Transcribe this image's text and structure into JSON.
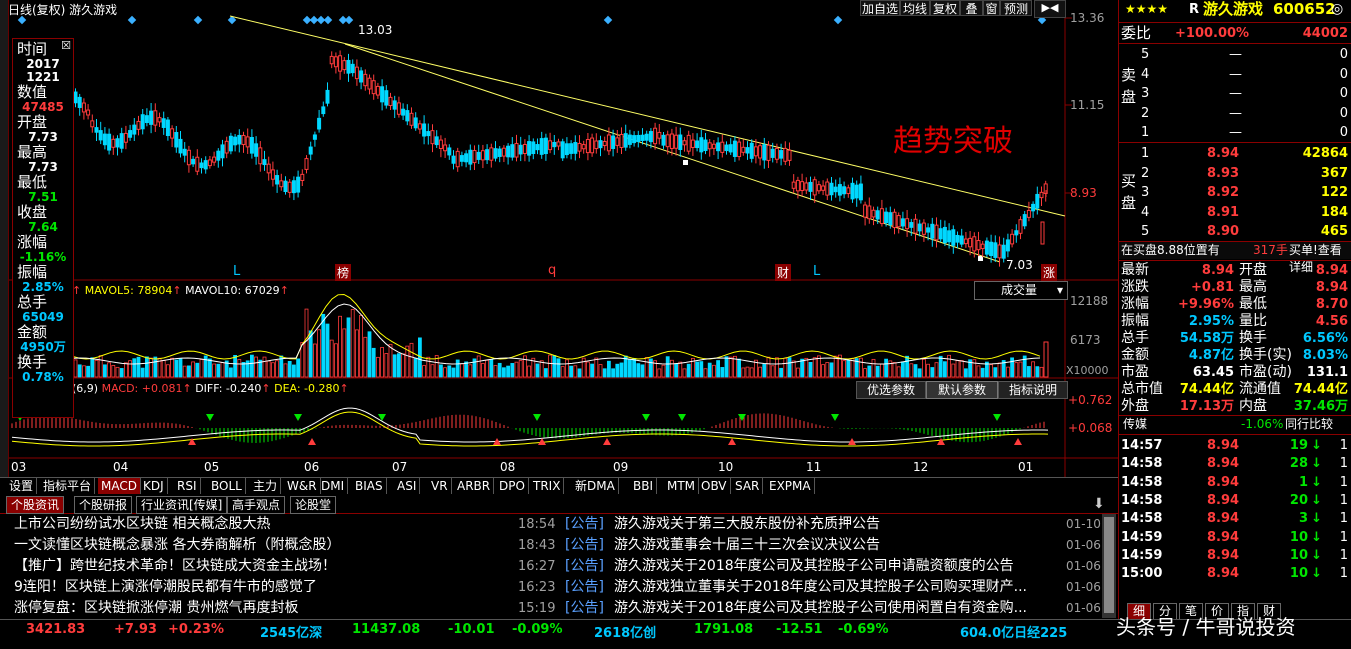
{
  "chart_title": "日线(复权)  游久游戏",
  "toolbar": [
    "加自选",
    "均线",
    "复权",
    "叠",
    "窗",
    "预测"
  ],
  "price_axis": [
    "13.36",
    "11.15",
    "8.93"
  ],
  "vol_axis": [
    "12188",
    "6173",
    "X10000"
  ],
  "macd_axis": [
    "0.762",
    "0.068"
  ],
  "months": [
    "03",
    "04",
    "05",
    "06",
    "07",
    "08",
    "09",
    "10",
    "11",
    "12",
    "01"
  ],
  "annot_high": "13.03",
  "annot_low": "7.03",
  "trend_text": "趋势突破",
  "markers": [
    "L",
    "榜",
    "q",
    "财",
    "L",
    "涨"
  ],
  "mavol": {
    "l5": "MAVOL5: 78904",
    "l10": "MAVOL10: 67029",
    "sel": "成交量"
  },
  "macd_legend": {
    "p": "(6,9)",
    "macd": "MACD: +0.081",
    "diff": "DIFF: -0.240",
    "dea": "DEA: -0.280"
  },
  "param_btns": [
    "优选参数",
    "默认参数",
    "指标说明"
  ],
  "info": [
    {
      "k": "时间",
      "v": "2017",
      "c": "white"
    },
    {
      "k": "",
      "v": "1221",
      "c": "white"
    },
    {
      "k": "数值",
      "v": "47485",
      "c": "red"
    },
    {
      "k": "开盘",
      "v": "7.73",
      "c": "white"
    },
    {
      "k": "最高",
      "v": "7.73",
      "c": "white"
    },
    {
      "k": "最低",
      "v": "7.51",
      "c": "green"
    },
    {
      "k": "收盘",
      "v": "7.64",
      "c": "green"
    },
    {
      "k": "涨幅",
      "v": "-1.16%",
      "c": "green"
    },
    {
      "k": "振幅",
      "v": "2.85%",
      "c": "cyan"
    },
    {
      "k": "总手",
      "v": "65049",
      "c": "cyan"
    },
    {
      "k": "金额",
      "v": "4950万",
      "c": "cyan"
    },
    {
      "k": "换手",
      "v": "0.78%",
      "c": "cyan"
    }
  ],
  "indicator_tabs": [
    "设置",
    "指标平台",
    "MACD",
    "KDJ",
    "RSI",
    "BOLL",
    "主力",
    "W&R",
    "DMI",
    "BIAS",
    "ASI",
    "VR",
    "ARBR",
    "DPO",
    "TRIX",
    "新DMA",
    "BBI",
    "MTM",
    "OBV",
    "SAR",
    "EXPMA"
  ],
  "news_tabs": [
    "个股资讯",
    "个股研报",
    "行业资讯[传媒]",
    "高手观点",
    "论股堂"
  ],
  "news_left": [
    {
      "t": "上市公司纷纷试水区块链 相关概念股大热",
      "time": "18:54"
    },
    {
      "t": "一文读懂区块链概念暴涨 各大券商解析（附概念股）",
      "time": "18:43"
    },
    {
      "t": "【推广】跨世纪技术革命！区块链成大资金主战场！",
      "time": "16:27"
    },
    {
      "t": "9连阳！区块链上演涨停潮股民都有牛市的感觉了",
      "time": "16:23"
    },
    {
      "t": "涨停复盘：区块链掀涨停潮 贵州燃气再度封板",
      "time": "15:19"
    }
  ],
  "news_right": [
    {
      "tag": "[公告]",
      "t": "游久游戏关于第三大股东股份补充质押公告",
      "d": "01-10"
    },
    {
      "tag": "[公告]",
      "t": "游久游戏董事会十届三十三次会议决议公告",
      "d": "01-06"
    },
    {
      "tag": "[公告]",
      "t": "游久游戏关于2018年度公司及其控股子公司申请融资额度的公告",
      "d": "01-06"
    },
    {
      "tag": "[公告]",
      "t": "游久游戏独立董事关于2018年度公司及其控股子公司购买理财产...",
      "d": "01-06"
    },
    {
      "tag": "[公告]",
      "t": "游久游戏关于2018年度公司及其控股子公司使用闲置自有资金购...",
      "d": "01-06"
    }
  ],
  "stock": {
    "stars": "★★★★",
    "flag": "R",
    "name": "游久游戏",
    "code": "600652"
  },
  "weibi": {
    "label": "委比",
    "pct": "+100.00%",
    "val": "44002"
  },
  "sell_label": "卖盘",
  "buy_label": "买盘",
  "sells": [
    {
      "n": "5",
      "p": "—",
      "v": "0"
    },
    {
      "n": "4",
      "p": "—",
      "v": "0"
    },
    {
      "n": "3",
      "p": "—",
      "v": "0"
    },
    {
      "n": "2",
      "p": "—",
      "v": "0"
    },
    {
      "n": "1",
      "p": "—",
      "v": "0"
    }
  ],
  "buys": [
    {
      "n": "1",
      "p": "8.94",
      "v": "42864"
    },
    {
      "n": "2",
      "p": "8.93",
      "v": "367"
    },
    {
      "n": "3",
      "p": "8.92",
      "v": "122"
    },
    {
      "n": "4",
      "p": "8.91",
      "v": "184"
    },
    {
      "n": "5",
      "p": "8.90",
      "v": "465"
    }
  ],
  "buy_info": {
    "a": "在买盘8.88位置有",
    "b": "317手",
    "c": "买单!查看详细"
  },
  "quotes": [
    [
      "最新",
      "8.94",
      "开盘",
      "8.94"
    ],
    [
      "涨跌",
      "+0.81",
      "最高",
      "8.94"
    ],
    [
      "涨幅",
      "+9.96%",
      "最低",
      "8.70"
    ],
    [
      "振幅",
      "2.95%",
      "量比",
      "4.56"
    ],
    [
      "总手",
      "54.58万",
      "换手",
      "6.56%"
    ],
    [
      "金额",
      "4.87亿",
      "换手(实)",
      "8.03%"
    ],
    [
      "市盈",
      "63.45",
      "市盈(动)",
      "131.1"
    ],
    [
      "总市值",
      "74.44亿",
      "流通值",
      "74.44亿"
    ],
    [
      "外盘",
      "17.13万",
      "内盘",
      "37.46万"
    ]
  ],
  "sector": {
    "name": "传媒",
    "pct": "-1.06%",
    "cmp": "同行比较"
  },
  "ticks": [
    {
      "t": "14:57",
      "p": "8.94",
      "v": "19",
      "a": "↓"
    },
    {
      "t": "14:58",
      "p": "8.94",
      "v": "28",
      "a": "↓"
    },
    {
      "t": "14:58",
      "p": "8.94",
      "v": "1",
      "a": "↓"
    },
    {
      "t": "14:58",
      "p": "8.94",
      "v": "20",
      "a": "↓"
    },
    {
      "t": "14:58",
      "p": "8.94",
      "v": "3",
      "a": "↓"
    },
    {
      "t": "14:59",
      "p": "8.94",
      "v": "10",
      "a": "↓"
    },
    {
      "t": "14:59",
      "p": "8.94",
      "v": "10",
      "a": "↓"
    },
    {
      "t": "15:00",
      "p": "8.94",
      "v": "10",
      "a": "↓"
    }
  ],
  "right_tabs": [
    "细",
    "分",
    "笔",
    "价",
    "指",
    "财"
  ],
  "status": [
    {
      "t": "3421.83",
      "c": "red"
    },
    {
      "t": "+7.93",
      "c": "red"
    },
    {
      "t": "+0.23%",
      "c": "red"
    },
    {
      "t": "2545亿深",
      "c": "cyan"
    },
    {
      "t": "11437.08",
      "c": "green"
    },
    {
      "t": "-10.01",
      "c": "green"
    },
    {
      "t": "-0.09%",
      "c": "green"
    },
    {
      "t": "2618亿创",
      "c": "cyan"
    },
    {
      "t": "1791.08",
      "c": "green"
    },
    {
      "t": "-12.51",
      "c": "green"
    },
    {
      "t": "-0.69%",
      "c": "green"
    },
    {
      "t": "604.0亿日经225",
      "c": "cyan"
    }
  ],
  "watermark": "头条号 / 牛哥说投资",
  "colors": {
    "up": "#ff3c3c",
    "down": "#00c8ff",
    "trend": "#ffff66",
    "accent": "#8a0000"
  }
}
